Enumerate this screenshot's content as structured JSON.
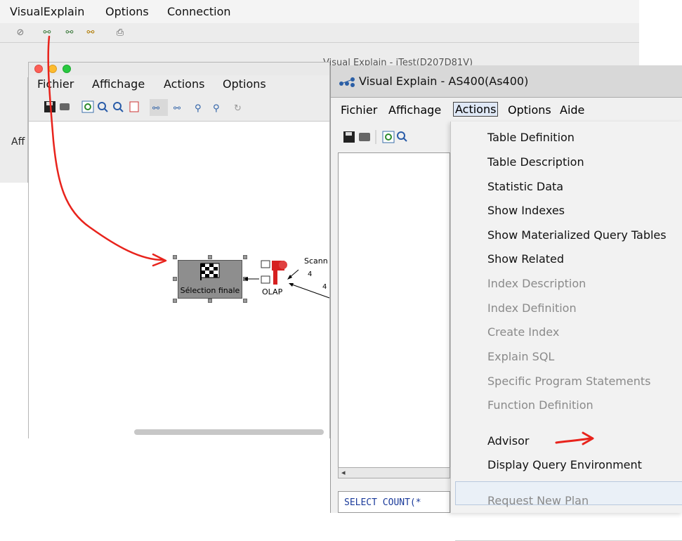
{
  "bg_app": {
    "menu": [
      "VisualExplain",
      "Options",
      "Connection"
    ],
    "window_title_peek": "Visual Explain - iTest(D207D81V)",
    "side_label": "Aff"
  },
  "mac_window": {
    "menu": [
      "Fichier",
      "Affichage",
      "Actions",
      "Options"
    ],
    "nodes": {
      "final_label": "Sélection finale",
      "olap_label": "OLAP",
      "scan_label": "Scann",
      "count_a": "4",
      "count_b": "4"
    }
  },
  "ve_window": {
    "title": "Visual Explain - AS400(As400)",
    "menu": [
      "Fichier",
      "Affichage",
      "Actions",
      "Options",
      "Aide"
    ],
    "active_menu": "Actions",
    "sql_preview": "SELECT COUNT(*",
    "actions_menu": [
      {
        "label": "Table Definition",
        "enabled": true
      },
      {
        "label": "Table Description",
        "enabled": true
      },
      {
        "label": "Statistic Data",
        "enabled": true
      },
      {
        "label": "Show Indexes",
        "enabled": true
      },
      {
        "label": "Show Materialized Query Tables",
        "enabled": true
      },
      {
        "label": "Show Related",
        "enabled": true
      },
      {
        "label": "Index Description",
        "enabled": false
      },
      {
        "label": "Index Definition",
        "enabled": false
      },
      {
        "label": "Create Index",
        "enabled": false
      },
      {
        "label": "Explain SQL",
        "enabled": false
      },
      {
        "label": "Specific Program Statements",
        "enabled": false
      },
      {
        "label": "Function Definition",
        "enabled": false
      },
      {
        "label": "Advisor",
        "enabled": true,
        "highlighted": true
      },
      {
        "label": "Display Query Environment",
        "enabled": true
      },
      {
        "label": "Request New Plan",
        "enabled": false
      }
    ]
  },
  "colors": {
    "annotation_arrow": "#e8231c",
    "highlight": "#eaf0f7",
    "disabled_text": "#8a8a8a"
  }
}
